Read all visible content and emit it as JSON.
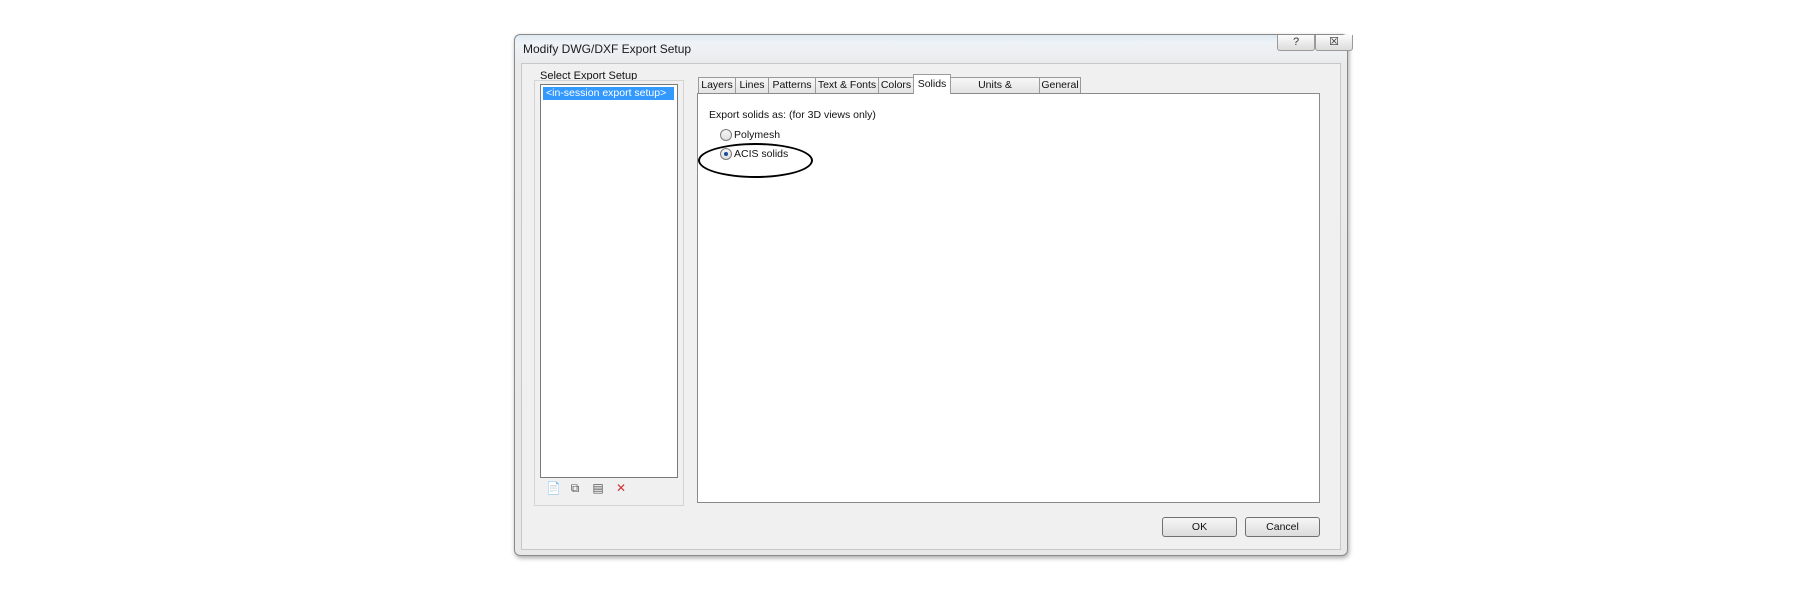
{
  "window": {
    "title": "Modify DWG/DXF Export Setup",
    "help_glyph": "?",
    "close_glyph": "☒"
  },
  "left_panel": {
    "label": "Select Export Setup",
    "items": [
      "<in-session export setup>"
    ],
    "tools": [
      {
        "icon": "new-setup-icon",
        "glyph": "📄"
      },
      {
        "icon": "duplicate-setup-icon",
        "glyph": "⧉"
      },
      {
        "icon": "rename-setup-icon",
        "glyph": "▤"
      },
      {
        "icon": "delete-setup-icon",
        "glyph": "✕"
      }
    ]
  },
  "tabs": [
    "Layers",
    "Lines",
    "Patterns",
    "Text & Fonts",
    "Colors",
    "Solids",
    "Units & Coordinates",
    "General"
  ],
  "active_tab": "Solids",
  "solids": {
    "label": "Export solids as: (for 3D views only)",
    "options": [
      {
        "label": "Polymesh",
        "checked": false
      },
      {
        "label": "ACIS solids",
        "checked": true
      }
    ]
  },
  "buttons": {
    "ok": "OK",
    "cancel": "Cancel"
  }
}
